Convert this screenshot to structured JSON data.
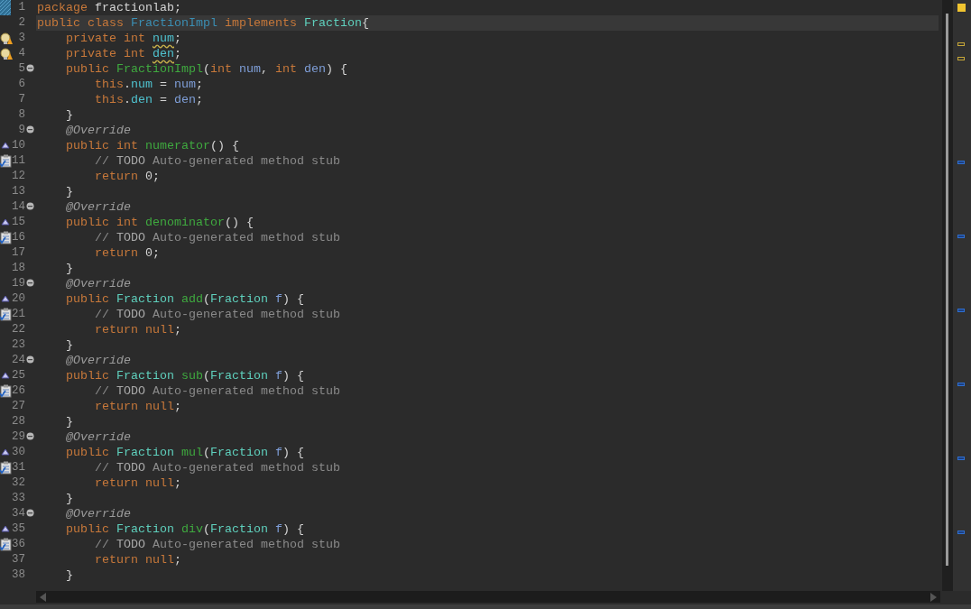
{
  "lines": [
    {
      "number": "1",
      "kind": "current",
      "highlighted": false,
      "tokens": [
        {
          "kind": "kw",
          "text": "package"
        },
        {
          "kind": "plain",
          "text": " fractionlab;"
        }
      ]
    },
    {
      "number": "2",
      "kind": "none",
      "highlighted": true,
      "tokens": [
        {
          "kind": "kw",
          "text": "public class "
        },
        {
          "kind": "cls",
          "text": "FractionImpl"
        },
        {
          "kind": "kw",
          "text": " implements "
        },
        {
          "kind": "type",
          "text": "Fraction"
        },
        {
          "kind": "plain",
          "text": "{"
        }
      ]
    },
    {
      "number": "3",
      "kind": "warning",
      "highlighted": false,
      "tokens": [
        {
          "kind": "kw",
          "text": "private int "
        },
        {
          "kind": "field_warn",
          "text": "num"
        },
        {
          "kind": "plain",
          "text": ";"
        }
      ]
    },
    {
      "number": "4",
      "kind": "warning",
      "highlighted": false,
      "tokens": [
        {
          "kind": "kw",
          "text": "private int "
        },
        {
          "kind": "field_warn",
          "text": "den"
        },
        {
          "kind": "plain",
          "text": ";"
        }
      ]
    },
    {
      "number": "5",
      "kind": "fold",
      "highlighted": false,
      "tokens": [
        {
          "kind": "kw",
          "text": "public "
        },
        {
          "kind": "method",
          "text": "FractionImpl"
        },
        {
          "kind": "plain",
          "text": "("
        },
        {
          "kind": "kw",
          "text": "int "
        },
        {
          "kind": "param",
          "text": "num"
        },
        {
          "kind": "plain",
          "text": ", "
        },
        {
          "kind": "kw",
          "text": "int "
        },
        {
          "kind": "param",
          "text": "den"
        },
        {
          "kind": "plain",
          "text": ") {"
        }
      ]
    },
    {
      "number": "6",
      "kind": "none",
      "highlighted": false,
      "tokens": [
        {
          "kind": "kw",
          "text": "this"
        },
        {
          "kind": "plain",
          "text": "."
        },
        {
          "kind": "field",
          "text": "num"
        },
        {
          "kind": "plain",
          "text": " = "
        },
        {
          "kind": "param",
          "text": "num"
        },
        {
          "kind": "plain",
          "text": ";"
        }
      ]
    },
    {
      "number": "7",
      "kind": "none",
      "highlighted": false,
      "tokens": [
        {
          "kind": "kw",
          "text": "this"
        },
        {
          "kind": "plain",
          "text": "."
        },
        {
          "kind": "field",
          "text": "den"
        },
        {
          "kind": "plain",
          "text": " = "
        },
        {
          "kind": "param",
          "text": "den"
        },
        {
          "kind": "plain",
          "text": ";"
        }
      ]
    },
    {
      "number": "8",
      "kind": "none",
      "highlighted": false,
      "tokens": [
        {
          "kind": "plain",
          "text": "}"
        }
      ]
    },
    {
      "number": "9",
      "kind": "fold",
      "highlighted": false,
      "tokens": [
        {
          "kind": "ann",
          "text": "@Override"
        }
      ]
    },
    {
      "number": "10",
      "kind": "override",
      "highlighted": false,
      "tokens": [
        {
          "kind": "kw",
          "text": "public int "
        },
        {
          "kind": "method",
          "text": "numerator"
        },
        {
          "kind": "plain",
          "text": "() {"
        }
      ]
    },
    {
      "number": "11",
      "kind": "task",
      "highlighted": false,
      "tokens": [
        {
          "kind": "comment",
          "text": "// "
        },
        {
          "kind": "todo",
          "text": "TODO"
        },
        {
          "kind": "comment",
          "text": " Auto-generated method stub"
        }
      ]
    },
    {
      "number": "12",
      "kind": "none",
      "highlighted": false,
      "tokens": [
        {
          "kind": "kw",
          "text": "return "
        },
        {
          "kind": "plain",
          "text": "0;"
        }
      ]
    },
    {
      "number": "13",
      "kind": "none",
      "highlighted": false,
      "tokens": [
        {
          "kind": "plain",
          "text": "}"
        }
      ]
    },
    {
      "number": "14",
      "kind": "fold",
      "highlighted": false,
      "tokens": [
        {
          "kind": "ann",
          "text": "@Override"
        }
      ]
    },
    {
      "number": "15",
      "kind": "override",
      "highlighted": false,
      "tokens": [
        {
          "kind": "kw",
          "text": "public int "
        },
        {
          "kind": "method",
          "text": "denominator"
        },
        {
          "kind": "plain",
          "text": "() {"
        }
      ]
    },
    {
      "number": "16",
      "kind": "task",
      "highlighted": false,
      "tokens": [
        {
          "kind": "comment",
          "text": "// "
        },
        {
          "kind": "todo",
          "text": "TODO"
        },
        {
          "kind": "comment",
          "text": " Auto-generated method stub"
        }
      ]
    },
    {
      "number": "17",
      "kind": "none",
      "highlighted": false,
      "tokens": [
        {
          "kind": "kw",
          "text": "return "
        },
        {
          "kind": "plain",
          "text": "0;"
        }
      ]
    },
    {
      "number": "18",
      "kind": "none",
      "highlighted": false,
      "tokens": [
        {
          "kind": "plain",
          "text": "}"
        }
      ]
    },
    {
      "number": "19",
      "kind": "fold",
      "highlighted": false,
      "tokens": [
        {
          "kind": "ann",
          "text": "@Override"
        }
      ]
    },
    {
      "number": "20",
      "kind": "override",
      "highlighted": false,
      "tokens": [
        {
          "kind": "kw",
          "text": "public "
        },
        {
          "kind": "type",
          "text": "Fraction"
        },
        {
          "kind": "method",
          "text": " add"
        },
        {
          "kind": "plain",
          "text": "("
        },
        {
          "kind": "type",
          "text": "Fraction"
        },
        {
          "kind": "param",
          "text": " f"
        },
        {
          "kind": "plain",
          "text": ") {"
        }
      ]
    },
    {
      "number": "21",
      "kind": "task",
      "highlighted": false,
      "tokens": [
        {
          "kind": "comment",
          "text": "// "
        },
        {
          "kind": "todo",
          "text": "TODO"
        },
        {
          "kind": "comment",
          "text": " Auto-generated method stub"
        }
      ]
    },
    {
      "number": "22",
      "kind": "none",
      "highlighted": false,
      "tokens": [
        {
          "kind": "kw",
          "text": "return null"
        },
        {
          "kind": "plain",
          "text": ";"
        }
      ]
    },
    {
      "number": "23",
      "kind": "none",
      "highlighted": false,
      "tokens": [
        {
          "kind": "plain",
          "text": "}"
        }
      ]
    },
    {
      "number": "24",
      "kind": "fold",
      "highlighted": false,
      "tokens": [
        {
          "kind": "ann",
          "text": "@Override"
        }
      ]
    },
    {
      "number": "25",
      "kind": "override",
      "highlighted": false,
      "tokens": [
        {
          "kind": "kw",
          "text": "public "
        },
        {
          "kind": "type",
          "text": "Fraction"
        },
        {
          "kind": "method",
          "text": " sub"
        },
        {
          "kind": "plain",
          "text": "("
        },
        {
          "kind": "type",
          "text": "Fraction"
        },
        {
          "kind": "param",
          "text": " f"
        },
        {
          "kind": "plain",
          "text": ") {"
        }
      ]
    },
    {
      "number": "26",
      "kind": "task",
      "highlighted": false,
      "tokens": [
        {
          "kind": "comment",
          "text": "// "
        },
        {
          "kind": "todo",
          "text": "TODO"
        },
        {
          "kind": "comment",
          "text": " Auto-generated method stub"
        }
      ]
    },
    {
      "number": "27",
      "kind": "none",
      "highlighted": false,
      "tokens": [
        {
          "kind": "kw",
          "text": "return null"
        },
        {
          "kind": "plain",
          "text": ";"
        }
      ]
    },
    {
      "number": "28",
      "kind": "none",
      "highlighted": false,
      "tokens": [
        {
          "kind": "plain",
          "text": "}"
        }
      ]
    },
    {
      "number": "29",
      "kind": "fold",
      "highlighted": false,
      "tokens": [
        {
          "kind": "ann",
          "text": "@Override"
        }
      ]
    },
    {
      "number": "30",
      "kind": "override",
      "highlighted": false,
      "tokens": [
        {
          "kind": "kw",
          "text": "public "
        },
        {
          "kind": "type",
          "text": "Fraction"
        },
        {
          "kind": "method",
          "text": " mul"
        },
        {
          "kind": "plain",
          "text": "("
        },
        {
          "kind": "type",
          "text": "Fraction"
        },
        {
          "kind": "param",
          "text": " f"
        },
        {
          "kind": "plain",
          "text": ") {"
        }
      ]
    },
    {
      "number": "31",
      "kind": "task",
      "highlighted": false,
      "tokens": [
        {
          "kind": "comment",
          "text": "// "
        },
        {
          "kind": "todo",
          "text": "TODO"
        },
        {
          "kind": "comment",
          "text": " Auto-generated method stub"
        }
      ]
    },
    {
      "number": "32",
      "kind": "none",
      "highlighted": false,
      "tokens": [
        {
          "kind": "kw",
          "text": "return null"
        },
        {
          "kind": "plain",
          "text": ";"
        }
      ]
    },
    {
      "number": "33",
      "kind": "none",
      "highlighted": false,
      "tokens": [
        {
          "kind": "plain",
          "text": "}"
        }
      ]
    },
    {
      "number": "34",
      "kind": "fold",
      "highlighted": false,
      "tokens": [
        {
          "kind": "ann",
          "text": "@Override"
        }
      ]
    },
    {
      "number": "35",
      "kind": "override",
      "highlighted": false,
      "tokens": [
        {
          "kind": "kw",
          "text": "public "
        },
        {
          "kind": "type",
          "text": "Fraction"
        },
        {
          "kind": "method",
          "text": " div"
        },
        {
          "kind": "plain",
          "text": "("
        },
        {
          "kind": "type",
          "text": "Fraction"
        },
        {
          "kind": "param",
          "text": " f"
        },
        {
          "kind": "plain",
          "text": ") {"
        }
      ]
    },
    {
      "number": "36",
      "kind": "task",
      "highlighted": false,
      "tokens": [
        {
          "kind": "comment",
          "text": "// "
        },
        {
          "kind": "todo",
          "text": "TODO"
        },
        {
          "kind": "comment",
          "text": " Auto-generated method stub"
        }
      ]
    },
    {
      "number": "37",
      "kind": "none",
      "highlighted": false,
      "tokens": [
        {
          "kind": "kw",
          "text": "return null"
        },
        {
          "kind": "plain",
          "text": ";"
        }
      ]
    },
    {
      "number": "38",
      "kind": "none",
      "highlighted": false,
      "tokens": [
        {
          "kind": "plain",
          "text": "}"
        }
      ]
    }
  ]
}
